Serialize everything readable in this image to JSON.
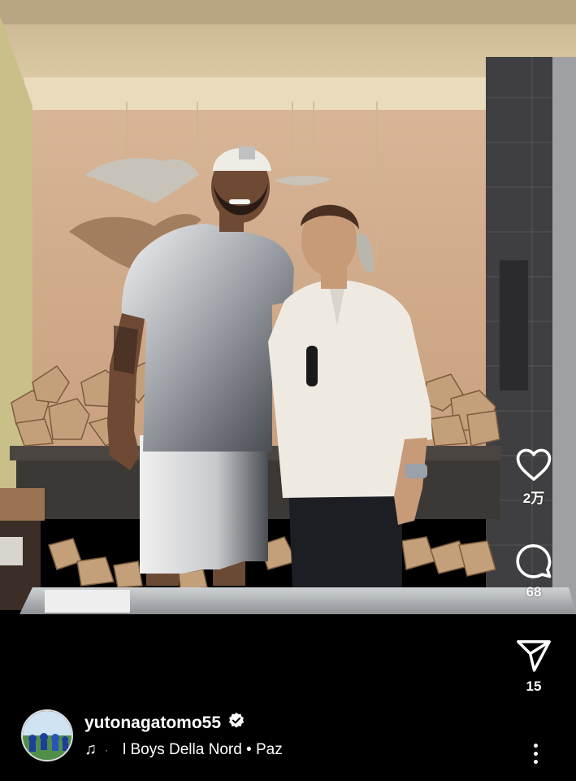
{
  "post": {
    "username": "yutonagatomo55",
    "verified": true,
    "audio": {
      "dot": "·",
      "text": "l Boys Della Nord • Paz"
    }
  },
  "actions": {
    "likes": "2万",
    "comments": "68",
    "shares": "15"
  },
  "icons": {
    "like": "heart-icon",
    "comment": "comment-bubble-icon",
    "share": "paper-plane-icon",
    "more": "more-vertical-icon",
    "music": "music-note-icon",
    "verified": "verified-badge-icon"
  },
  "colors": {
    "background": "#000000",
    "text": "#ffffff"
  }
}
